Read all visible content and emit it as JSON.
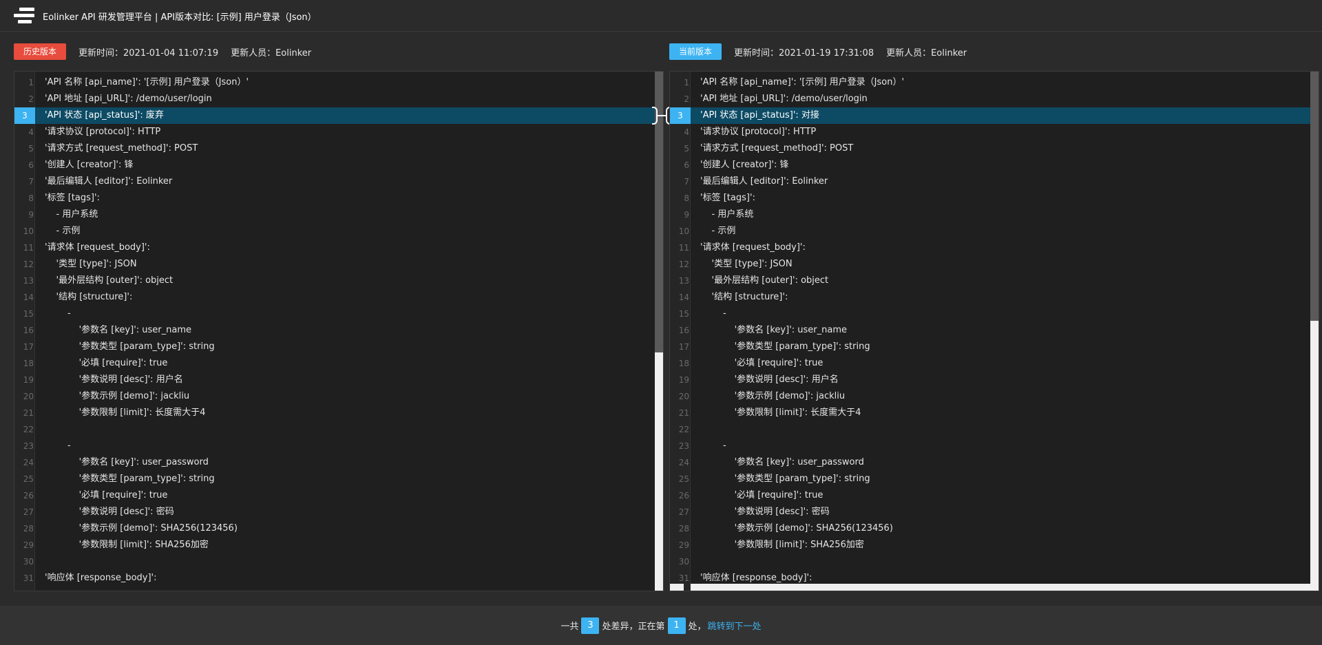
{
  "header": {
    "title": "Eolinker API 研发管理平台 | API版本对比: [示例] 用户登录（Json）"
  },
  "left": {
    "badge": "历史版本",
    "update_time": "更新时间：2021-01-04 11:07:19",
    "updater": "更新人员：Eolinker",
    "lines": [
      {
        "n": "1",
        "text": "'API 名称 [api_name]': '[示例] 用户登录（Json）'",
        "hl": false
      },
      {
        "n": "2",
        "text": "'API 地址 [api_URL]': /demo/user/login",
        "hl": false
      },
      {
        "n": "3",
        "text": "'API 状态 [api_status]': 废弃",
        "hl": true
      },
      {
        "n": "4",
        "text": "'请求协议 [protocol]': HTTP",
        "hl": false
      },
      {
        "n": "5",
        "text": "'请求方式 [request_method]': POST",
        "hl": false
      },
      {
        "n": "6",
        "text": "'创建人 [creator]': 锋",
        "hl": false
      },
      {
        "n": "7",
        "text": "'最后编辑人 [editor]': Eolinker",
        "hl": false
      },
      {
        "n": "8",
        "text": "'标签 [tags]':",
        "hl": false
      },
      {
        "n": "9",
        "text": "    - 用户系统",
        "hl": false
      },
      {
        "n": "10",
        "text": "    - 示例",
        "hl": false
      },
      {
        "n": "11",
        "text": "'请求体 [request_body]':",
        "hl": false
      },
      {
        "n": "12",
        "text": "    '类型 [type]': JSON",
        "hl": false
      },
      {
        "n": "13",
        "text": "    '最外层结构 [outer]': object",
        "hl": false
      },
      {
        "n": "14",
        "text": "    '结构 [structure]':",
        "hl": false
      },
      {
        "n": "15",
        "text": "        -",
        "hl": false
      },
      {
        "n": "16",
        "text": "            '参数名 [key]': user_name",
        "hl": false
      },
      {
        "n": "17",
        "text": "            '参数类型 [param_type]': string",
        "hl": false
      },
      {
        "n": "18",
        "text": "            '必填 [require]': true",
        "hl": false
      },
      {
        "n": "19",
        "text": "            '参数说明 [desc]': 用户名",
        "hl": false
      },
      {
        "n": "20",
        "text": "            '参数示例 [demo]': jackliu",
        "hl": false
      },
      {
        "n": "21",
        "text": "            '参数限制 [limit]': 长度需大于4",
        "hl": false
      },
      {
        "n": "22",
        "text": "",
        "hl": false
      },
      {
        "n": "23",
        "text": "        -",
        "hl": false
      },
      {
        "n": "24",
        "text": "            '参数名 [key]': user_password",
        "hl": false
      },
      {
        "n": "25",
        "text": "            '参数类型 [param_type]': string",
        "hl": false
      },
      {
        "n": "26",
        "text": "            '必填 [require]': true",
        "hl": false
      },
      {
        "n": "27",
        "text": "            '参数说明 [desc]': 密码",
        "hl": false
      },
      {
        "n": "28",
        "text": "            '参数示例 [demo]': SHA256(123456)",
        "hl": false
      },
      {
        "n": "29",
        "text": "            '参数限制 [limit]': SHA256加密",
        "hl": false
      },
      {
        "n": "30",
        "text": "",
        "hl": false
      },
      {
        "n": "31",
        "text": "'响应体 [response_body]':",
        "hl": false
      }
    ]
  },
  "right": {
    "badge": "当前版本",
    "update_time": "更新时间：2021-01-19 17:31:08",
    "updater": "更新人员：Eolinker",
    "lines": [
      {
        "n": "1",
        "text": "'API 名称 [api_name]': '[示例] 用户登录（Json）'",
        "hl": false
      },
      {
        "n": "2",
        "text": "'API 地址 [api_URL]': /demo/user/login",
        "hl": false
      },
      {
        "n": "3",
        "text": "'API 状态 [api_status]': 对接",
        "hl": true
      },
      {
        "n": "4",
        "text": "'请求协议 [protocol]': HTTP",
        "hl": false
      },
      {
        "n": "5",
        "text": "'请求方式 [request_method]': POST",
        "hl": false
      },
      {
        "n": "6",
        "text": "'创建人 [creator]': 锋",
        "hl": false
      },
      {
        "n": "7",
        "text": "'最后编辑人 [editor]': Eolinker",
        "hl": false
      },
      {
        "n": "8",
        "text": "'标签 [tags]':",
        "hl": false
      },
      {
        "n": "9",
        "text": "    - 用户系统",
        "hl": false
      },
      {
        "n": "10",
        "text": "    - 示例",
        "hl": false
      },
      {
        "n": "11",
        "text": "'请求体 [request_body]':",
        "hl": false
      },
      {
        "n": "12",
        "text": "    '类型 [type]': JSON",
        "hl": false
      },
      {
        "n": "13",
        "text": "    '最外层结构 [outer]': object",
        "hl": false
      },
      {
        "n": "14",
        "text": "    '结构 [structure]':",
        "hl": false
      },
      {
        "n": "15",
        "text": "        -",
        "hl": false
      },
      {
        "n": "16",
        "text": "            '参数名 [key]': user_name",
        "hl": false
      },
      {
        "n": "17",
        "text": "            '参数类型 [param_type]': string",
        "hl": false
      },
      {
        "n": "18",
        "text": "            '必填 [require]': true",
        "hl": false
      },
      {
        "n": "19",
        "text": "            '参数说明 [desc]': 用户名",
        "hl": false
      },
      {
        "n": "20",
        "text": "            '参数示例 [demo]': jackliu",
        "hl": false
      },
      {
        "n": "21",
        "text": "            '参数限制 [limit]': 长度需大于4",
        "hl": false
      },
      {
        "n": "22",
        "text": "",
        "hl": false
      },
      {
        "n": "23",
        "text": "        -",
        "hl": false
      },
      {
        "n": "24",
        "text": "            '参数名 [key]': user_password",
        "hl": false
      },
      {
        "n": "25",
        "text": "            '参数类型 [param_type]': string",
        "hl": false
      },
      {
        "n": "26",
        "text": "            '必填 [require]': true",
        "hl": false
      },
      {
        "n": "27",
        "text": "            '参数说明 [desc]': 密码",
        "hl": false
      },
      {
        "n": "28",
        "text": "            '参数示例 [demo]': SHA256(123456)",
        "hl": false
      },
      {
        "n": "29",
        "text": "            '参数限制 [limit]': SHA256加密",
        "hl": false
      },
      {
        "n": "30",
        "text": "",
        "hl": false
      },
      {
        "n": "31",
        "text": "'响应体 [response_body]':",
        "hl": false
      }
    ]
  },
  "footer": {
    "prefix": "一共",
    "total": "3",
    "middle": "处差异，正在第",
    "current": "1",
    "suffix": "处，",
    "next_link": "跳转到下一处"
  },
  "colors": {
    "highlight_row": "#0d4a64",
    "accent": "#3db3f2",
    "old_badge": "#e74c3c"
  }
}
